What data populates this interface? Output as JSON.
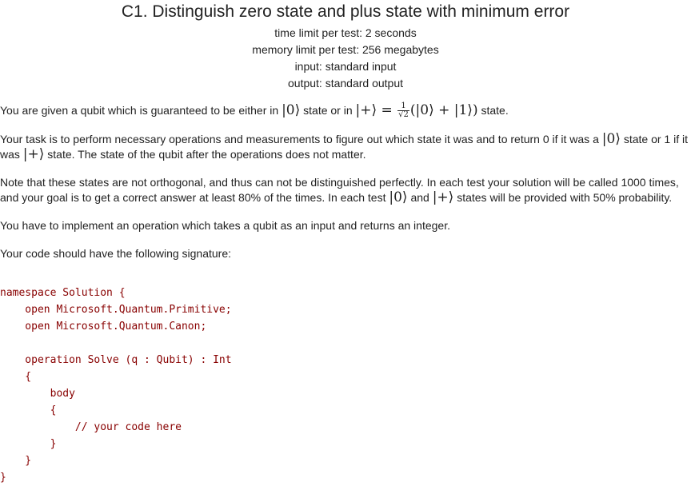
{
  "problem": {
    "title": "C1. Distinguish zero state and plus state with minimum error",
    "time_limit": "time limit per test: 2 seconds",
    "memory_limit": "memory limit per test: 256 megabytes",
    "input": "input: standard input",
    "output": "output: standard output"
  },
  "statement": {
    "p1_a": "You are given a qubit which is guaranteed to be either in ",
    "p1_ket0": "|0⟩",
    "p1_b": " state or in ",
    "p1_ketplus": "|+⟩ = ",
    "p1_frac_num": "1",
    "p1_frac_den": "√2",
    "p1_sum": "(|0⟩ + |1⟩)",
    "p1_c": " state.",
    "p2_a": "Your task is to perform necessary operations and measurements to figure out which state it was and to return 0 if it was a ",
    "p2_ket0": "|0⟩",
    "p2_b": " state or 1 if it was ",
    "p2_ketplus": "|+⟩",
    "p2_c": " state. The state of the qubit after the operations does not matter.",
    "p3_a": "Note that these states are not orthogonal, and thus can not be distinguished perfectly. In each test your solution will be called 1000 times, and your goal is to get a correct answer at least 80% of the times. In each test ",
    "p3_ket0": "|0⟩",
    "p3_b": " and ",
    "p3_ketplus": "|+⟩",
    "p3_c": " states will be provided with 50% probability.",
    "p4": "You have to implement an operation which takes a qubit as an input and returns an integer.",
    "p5": "Your code should have the following signature:"
  },
  "code": {
    "text": "namespace Solution {\n    open Microsoft.Quantum.Primitive;\n    open Microsoft.Quantum.Canon;\n\n    operation Solve (q : Qubit) : Int\n    {\n        body\n        {\n            // your code here\n        }\n    }\n}"
  }
}
